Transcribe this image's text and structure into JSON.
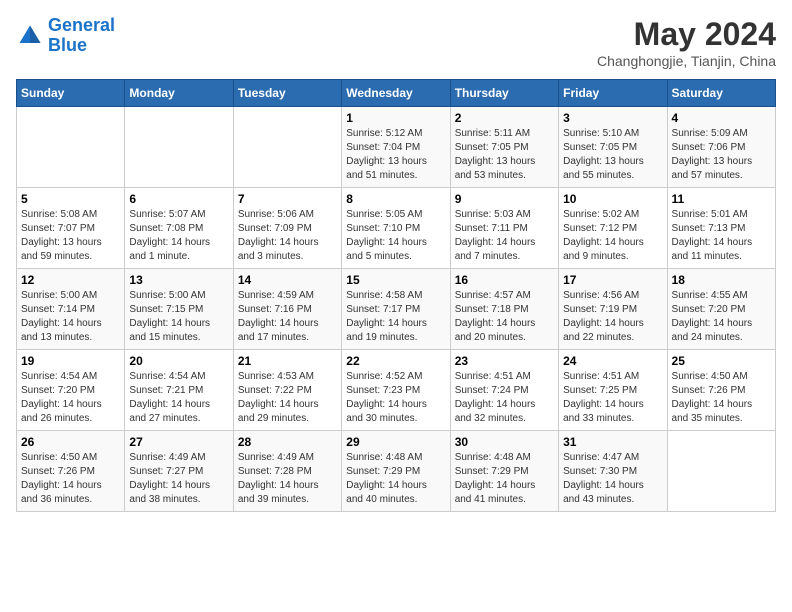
{
  "header": {
    "logo_line1": "General",
    "logo_line2": "Blue",
    "month": "May 2024",
    "location": "Changhongjie, Tianjin, China"
  },
  "weekdays": [
    "Sunday",
    "Monday",
    "Tuesday",
    "Wednesday",
    "Thursday",
    "Friday",
    "Saturday"
  ],
  "weeks": [
    [
      {
        "day": "",
        "sunrise": "",
        "sunset": "",
        "daylight": ""
      },
      {
        "day": "",
        "sunrise": "",
        "sunset": "",
        "daylight": ""
      },
      {
        "day": "",
        "sunrise": "",
        "sunset": "",
        "daylight": ""
      },
      {
        "day": "1",
        "sunrise": "Sunrise: 5:12 AM",
        "sunset": "Sunset: 7:04 PM",
        "daylight": "Daylight: 13 hours and 51 minutes."
      },
      {
        "day": "2",
        "sunrise": "Sunrise: 5:11 AM",
        "sunset": "Sunset: 7:05 PM",
        "daylight": "Daylight: 13 hours and 53 minutes."
      },
      {
        "day": "3",
        "sunrise": "Sunrise: 5:10 AM",
        "sunset": "Sunset: 7:05 PM",
        "daylight": "Daylight: 13 hours and 55 minutes."
      },
      {
        "day": "4",
        "sunrise": "Sunrise: 5:09 AM",
        "sunset": "Sunset: 7:06 PM",
        "daylight": "Daylight: 13 hours and 57 minutes."
      }
    ],
    [
      {
        "day": "5",
        "sunrise": "Sunrise: 5:08 AM",
        "sunset": "Sunset: 7:07 PM",
        "daylight": "Daylight: 13 hours and 59 minutes."
      },
      {
        "day": "6",
        "sunrise": "Sunrise: 5:07 AM",
        "sunset": "Sunset: 7:08 PM",
        "daylight": "Daylight: 14 hours and 1 minute."
      },
      {
        "day": "7",
        "sunrise": "Sunrise: 5:06 AM",
        "sunset": "Sunset: 7:09 PM",
        "daylight": "Daylight: 14 hours and 3 minutes."
      },
      {
        "day": "8",
        "sunrise": "Sunrise: 5:05 AM",
        "sunset": "Sunset: 7:10 PM",
        "daylight": "Daylight: 14 hours and 5 minutes."
      },
      {
        "day": "9",
        "sunrise": "Sunrise: 5:03 AM",
        "sunset": "Sunset: 7:11 PM",
        "daylight": "Daylight: 14 hours and 7 minutes."
      },
      {
        "day": "10",
        "sunrise": "Sunrise: 5:02 AM",
        "sunset": "Sunset: 7:12 PM",
        "daylight": "Daylight: 14 hours and 9 minutes."
      },
      {
        "day": "11",
        "sunrise": "Sunrise: 5:01 AM",
        "sunset": "Sunset: 7:13 PM",
        "daylight": "Daylight: 14 hours and 11 minutes."
      }
    ],
    [
      {
        "day": "12",
        "sunrise": "Sunrise: 5:00 AM",
        "sunset": "Sunset: 7:14 PM",
        "daylight": "Daylight: 14 hours and 13 minutes."
      },
      {
        "day": "13",
        "sunrise": "Sunrise: 5:00 AM",
        "sunset": "Sunset: 7:15 PM",
        "daylight": "Daylight: 14 hours and 15 minutes."
      },
      {
        "day": "14",
        "sunrise": "Sunrise: 4:59 AM",
        "sunset": "Sunset: 7:16 PM",
        "daylight": "Daylight: 14 hours and 17 minutes."
      },
      {
        "day": "15",
        "sunrise": "Sunrise: 4:58 AM",
        "sunset": "Sunset: 7:17 PM",
        "daylight": "Daylight: 14 hours and 19 minutes."
      },
      {
        "day": "16",
        "sunrise": "Sunrise: 4:57 AM",
        "sunset": "Sunset: 7:18 PM",
        "daylight": "Daylight: 14 hours and 20 minutes."
      },
      {
        "day": "17",
        "sunrise": "Sunrise: 4:56 AM",
        "sunset": "Sunset: 7:19 PM",
        "daylight": "Daylight: 14 hours and 22 minutes."
      },
      {
        "day": "18",
        "sunrise": "Sunrise: 4:55 AM",
        "sunset": "Sunset: 7:20 PM",
        "daylight": "Daylight: 14 hours and 24 minutes."
      }
    ],
    [
      {
        "day": "19",
        "sunrise": "Sunrise: 4:54 AM",
        "sunset": "Sunset: 7:20 PM",
        "daylight": "Daylight: 14 hours and 26 minutes."
      },
      {
        "day": "20",
        "sunrise": "Sunrise: 4:54 AM",
        "sunset": "Sunset: 7:21 PM",
        "daylight": "Daylight: 14 hours and 27 minutes."
      },
      {
        "day": "21",
        "sunrise": "Sunrise: 4:53 AM",
        "sunset": "Sunset: 7:22 PM",
        "daylight": "Daylight: 14 hours and 29 minutes."
      },
      {
        "day": "22",
        "sunrise": "Sunrise: 4:52 AM",
        "sunset": "Sunset: 7:23 PM",
        "daylight": "Daylight: 14 hours and 30 minutes."
      },
      {
        "day": "23",
        "sunrise": "Sunrise: 4:51 AM",
        "sunset": "Sunset: 7:24 PM",
        "daylight": "Daylight: 14 hours and 32 minutes."
      },
      {
        "day": "24",
        "sunrise": "Sunrise: 4:51 AM",
        "sunset": "Sunset: 7:25 PM",
        "daylight": "Daylight: 14 hours and 33 minutes."
      },
      {
        "day": "25",
        "sunrise": "Sunrise: 4:50 AM",
        "sunset": "Sunset: 7:26 PM",
        "daylight": "Daylight: 14 hours and 35 minutes."
      }
    ],
    [
      {
        "day": "26",
        "sunrise": "Sunrise: 4:50 AM",
        "sunset": "Sunset: 7:26 PM",
        "daylight": "Daylight: 14 hours and 36 minutes."
      },
      {
        "day": "27",
        "sunrise": "Sunrise: 4:49 AM",
        "sunset": "Sunset: 7:27 PM",
        "daylight": "Daylight: 14 hours and 38 minutes."
      },
      {
        "day": "28",
        "sunrise": "Sunrise: 4:49 AM",
        "sunset": "Sunset: 7:28 PM",
        "daylight": "Daylight: 14 hours and 39 minutes."
      },
      {
        "day": "29",
        "sunrise": "Sunrise: 4:48 AM",
        "sunset": "Sunset: 7:29 PM",
        "daylight": "Daylight: 14 hours and 40 minutes."
      },
      {
        "day": "30",
        "sunrise": "Sunrise: 4:48 AM",
        "sunset": "Sunset: 7:29 PM",
        "daylight": "Daylight: 14 hours and 41 minutes."
      },
      {
        "day": "31",
        "sunrise": "Sunrise: 4:47 AM",
        "sunset": "Sunset: 7:30 PM",
        "daylight": "Daylight: 14 hours and 43 minutes."
      },
      {
        "day": "",
        "sunrise": "",
        "sunset": "",
        "daylight": ""
      }
    ]
  ]
}
